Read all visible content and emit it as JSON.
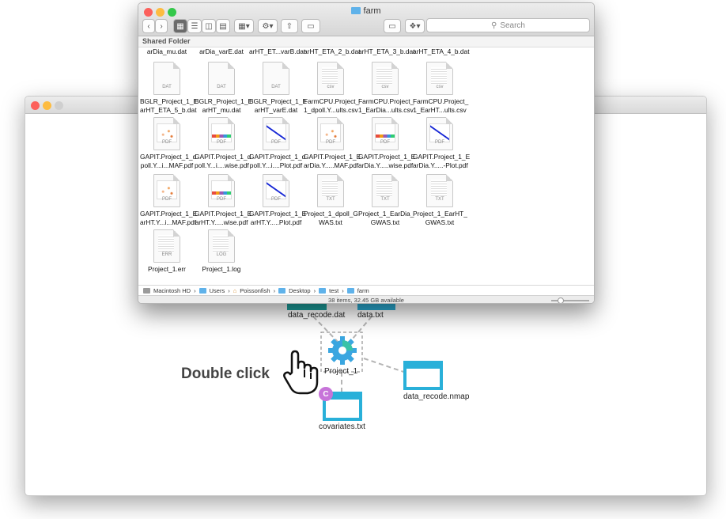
{
  "finder": {
    "title": "farm",
    "search_placeholder": "Search",
    "shared_header": "Shared Folder",
    "path": [
      "Macintosh HD",
      "Users",
      "Poissonfish",
      "Desktop",
      "test",
      "farm"
    ],
    "status": "38 items, 32.45 GB available",
    "files_top_partial": [
      "arDia_mu.dat",
      "arDia_varE.dat",
      "arHT_ET...varB.dat",
      "arHT_ETA_2_b.dat",
      "arHT_ETA_3_b.dat",
      "arHT_ETA_4_b.dat"
    ],
    "files": [
      {
        "l1": "BGLR_Project_1_E",
        "l2": "arHT_ETA_5_b.dat",
        "kind": "DAT"
      },
      {
        "l1": "BGLR_Project_1_E",
        "l2": "arHT_mu.dat",
        "kind": "DAT"
      },
      {
        "l1": "BGLR_Project_1_E",
        "l2": "arHT_varE.dat",
        "kind": "DAT"
      },
      {
        "l1": "FarmCPU.Project_",
        "l2": "1_dpoll.Y...ults.csv",
        "kind": "csv"
      },
      {
        "l1": "FarmCPU.Project_",
        "l2": "1_EarDia...ults.csv",
        "kind": "csv"
      },
      {
        "l1": "FarmCPU.Project_",
        "l2": "1_EarHT...ults.csv",
        "kind": "csv"
      },
      {
        "l1": "GAPIT.Project_1_d",
        "l2": "poll.Y...i...MAF.pdf",
        "kind": "PDF"
      },
      {
        "l1": "GAPIT.Project_1_d",
        "l2": "poll.Y...i....wise.pdf",
        "kind": "PDF"
      },
      {
        "l1": "GAPIT.Project_1_d",
        "l2": "poll.Y...i....Plot.pdf",
        "kind": "PDF"
      },
      {
        "l1": "GAPIT.Project_1_E",
        "l2": "arDia.Y.....MAF.pdf",
        "kind": "PDF"
      },
      {
        "l1": "GAPIT.Project_1_E",
        "l2": "arDia.Y.....wise.pdf",
        "kind": "PDF"
      },
      {
        "l1": "GAPIT.Project_1_E",
        "l2": "arDia.Y.....-Plot.pdf",
        "kind": "PDF"
      },
      {
        "l1": "GAPIT.Project_1_E",
        "l2": "arHT.Y...i...MAF.pdf",
        "kind": "PDF"
      },
      {
        "l1": "GAPIT.Project_1_E",
        "l2": "arHT.Y.....wise.pdf",
        "kind": "PDF"
      },
      {
        "l1": "GAPIT.Project_1_E",
        "l2": "arHT.Y.....Plot.pdf",
        "kind": "PDF"
      },
      {
        "l1": "Project_1_dpoll_G",
        "l2": "WAS.txt",
        "kind": "TXT"
      },
      {
        "l1": "Project_1_EarDia_",
        "l2": "GWAS.txt",
        "kind": "TXT"
      },
      {
        "l1": "Project_1_EarHT_",
        "l2": "GWAS.txt",
        "kind": "TXT"
      },
      {
        "l1": "Project_1.err",
        "l2": "",
        "kind": "ERR"
      },
      {
        "l1": "Project_1.log",
        "l2": "",
        "kind": "LOG"
      }
    ]
  },
  "canvas": {
    "instruction": "Double click",
    "nodes": {
      "data_recode": "data_recode.dat",
      "data_txt": "data.txt",
      "project": "Project_1",
      "nmap": "data_recode.nmap",
      "covariates": "covariates.txt",
      "badge": "C"
    }
  },
  "colors": {
    "accent": "#29b0d9",
    "gear": "#3aa6e0",
    "badge": "#c774d9",
    "traffic": [
      "#fc605b",
      "#fdbc40",
      "#34c84a"
    ]
  }
}
